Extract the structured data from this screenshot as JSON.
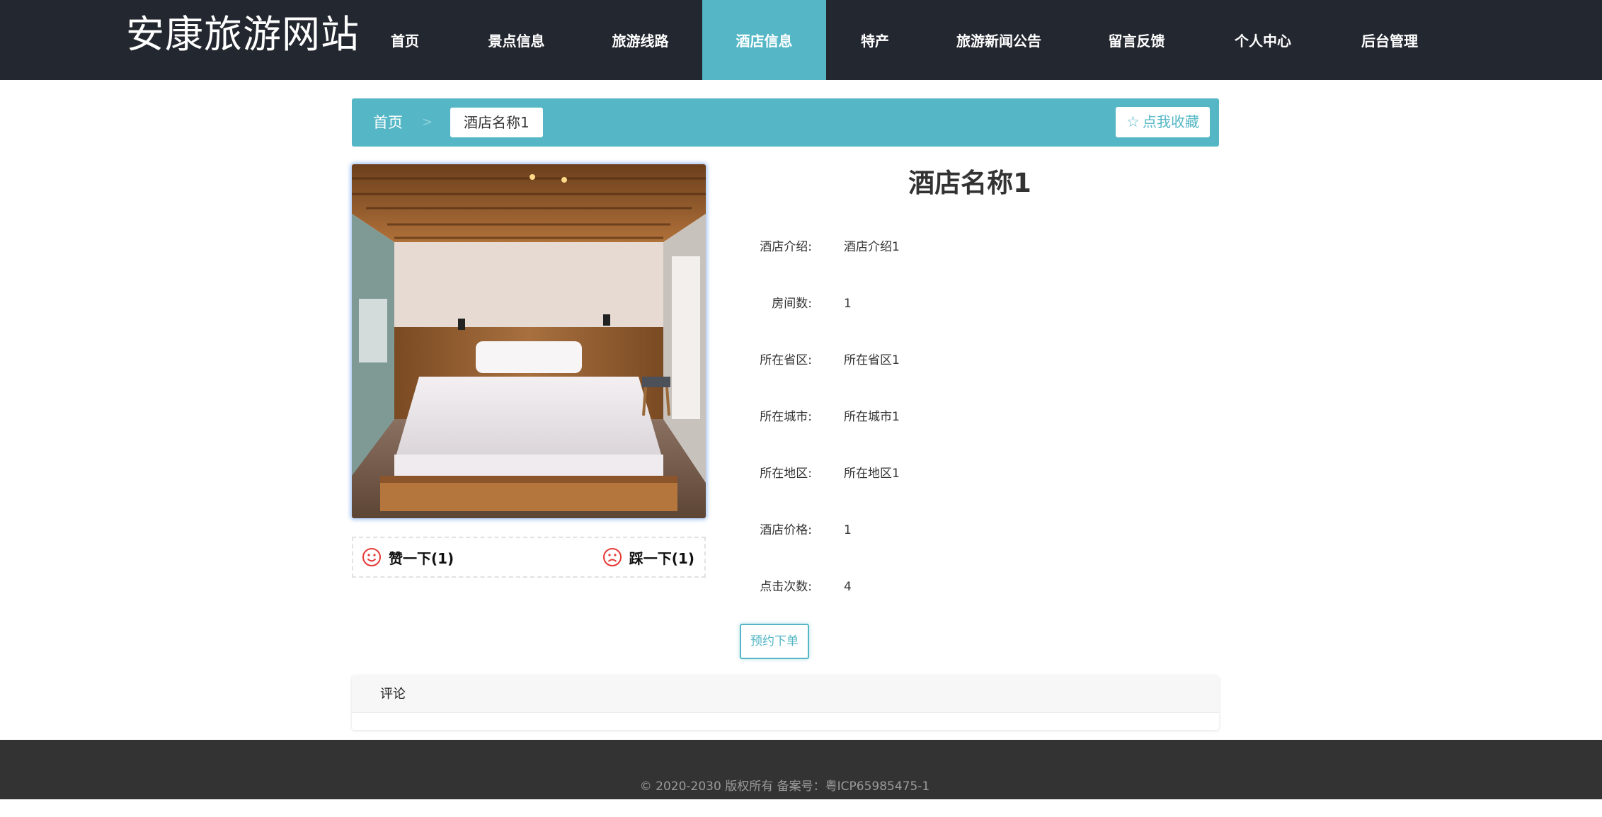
{
  "header": {
    "site_title": "安康旅游网站",
    "nav": [
      {
        "label": "首页",
        "active": false
      },
      {
        "label": "景点信息",
        "active": false
      },
      {
        "label": "旅游线路",
        "active": false
      },
      {
        "label": "酒店信息",
        "active": true
      },
      {
        "label": "特产",
        "active": false
      },
      {
        "label": "旅游新闻公告",
        "active": false
      },
      {
        "label": "留言反馈",
        "active": false
      },
      {
        "label": "个人中心",
        "active": false
      },
      {
        "label": "后台管理",
        "active": false
      }
    ]
  },
  "breadcrumb": {
    "home": "首页",
    "separator": ">",
    "current": "酒店名称1",
    "favorite_button": "点我收藏"
  },
  "votes": {
    "like_label": "赞一下(1)",
    "dislike_label": "踩一下(1)"
  },
  "detail": {
    "title": "酒店名称1",
    "fields": [
      {
        "label": "酒店介绍:",
        "value": "酒店介绍1"
      },
      {
        "label": "房间数:",
        "value": "1"
      },
      {
        "label": "所在省区:",
        "value": "所在省区1"
      },
      {
        "label": "所在城市:",
        "value": "所在城市1"
      },
      {
        "label": "所在地区:",
        "value": "所在地区1"
      },
      {
        "label": "酒店价格:",
        "value": "1"
      },
      {
        "label": "点击次数:",
        "value": "4"
      }
    ],
    "book_button": "预约下单"
  },
  "comments": {
    "heading": "评论"
  },
  "footer": {
    "copyright": "© 2020-2030 版权所有 备案号：粤ICP65985475-1"
  },
  "colors": {
    "header_bg": "#23272f",
    "accent": "#55b7c6",
    "footer_bg": "#333333",
    "vote_icon": "#e53935"
  },
  "icons": {
    "favorite": "star-outline-icon",
    "like": "smile-face-icon",
    "dislike": "sad-face-icon"
  }
}
